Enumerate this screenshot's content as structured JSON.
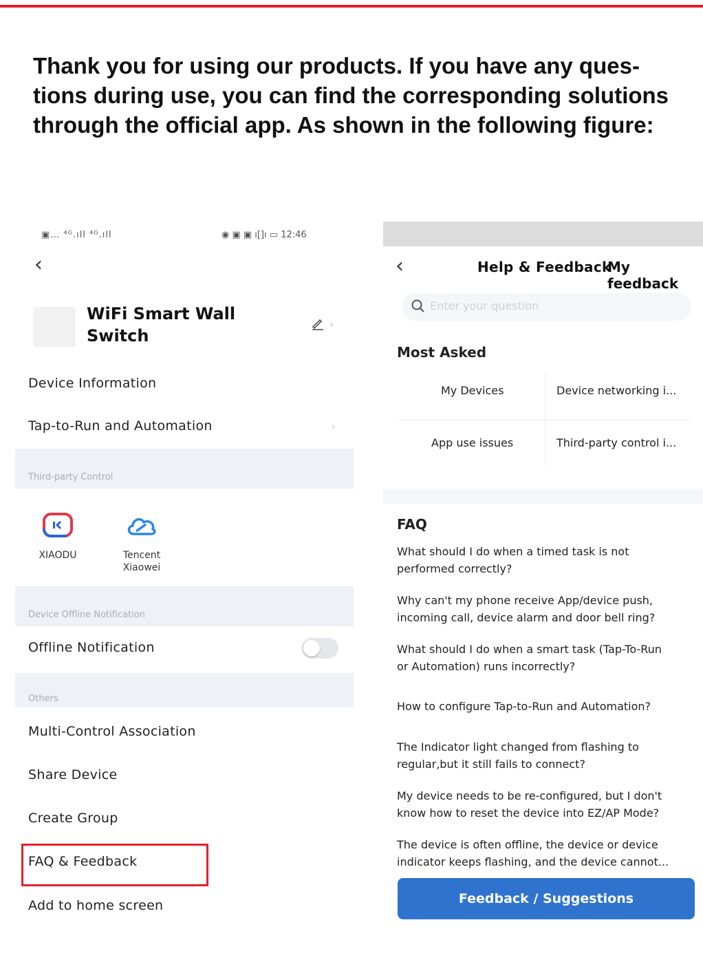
{
  "intro": {
    "line1": "Thank you for using our products. If you have any ques-",
    "line2": "tions during use, you can find the corresponding solutions",
    "line3": "through the official app. As shown in the following figure:"
  },
  "left_screen": {
    "status": {
      "left": "▣… ⁴ᴳ.ıll ⁴ᴳ.ıll",
      "right": "◉ ▣ ▣ ı[]ı ▭ 12:46"
    },
    "back_glyph": "‹",
    "device_name_line1": "WiFi Smart Wall",
    "device_name_line2": "Switch",
    "rows_top": [
      {
        "label": "Device Information"
      },
      {
        "label": "Tap-to-Run and Automation"
      }
    ],
    "third_party": {
      "section_label": "Third-party Control",
      "items": [
        {
          "name_line1": "XIAODU",
          "name_line2": "",
          "icon": "xiaodu-icon"
        },
        {
          "name_line1": "Tencent",
          "name_line2": "Xiaowei",
          "icon": "tencent-cloud-icon"
        }
      ]
    },
    "offline": {
      "section_label": "Device Offline Notification",
      "row_label": "Offline Notification",
      "toggle_on": false
    },
    "others": {
      "section_label": "Others",
      "rows": [
        {
          "label": "Multi-Control Association"
        },
        {
          "label": "Share Device"
        },
        {
          "label": "Create Group"
        },
        {
          "label": "FAQ & Feedback"
        },
        {
          "label": "Add to home screen"
        }
      ]
    },
    "highlight_color": "#e0212b"
  },
  "right_screen": {
    "back_glyph": "‹",
    "title": "Help & Feedback",
    "my_feedback": "My feedback",
    "search_placeholder": "Enter your question",
    "most_asked": {
      "heading": "Most Asked",
      "items": [
        "My Devices",
        "Device networking i...",
        "App use issues",
        "Third-party control i..."
      ]
    },
    "faq": {
      "heading": "FAQ",
      "items": [
        {
          "l1": "What should I do when a timed task is not",
          "l2": "performed correctly?"
        },
        {
          "l1": "Why can't my phone receive App/device push,",
          "l2": "incoming call, device alarm and door bell ring?"
        },
        {
          "l1": "What should I do when a smart task (Tap-To-Run",
          "l2": "or Automation) runs incorrectly?"
        },
        {
          "l1": "How to configure Tap-to-Run and Automation?",
          "l2": ""
        },
        {
          "l1": "The Indicator light changed from flashing to",
          "l2": "regular,but it still fails to connect?"
        },
        {
          "l1": "My device needs to be re-configured, but I don't",
          "l2": "know how to reset the device into EZ/AP Mode?"
        },
        {
          "l1": "The device is often offline, the device or device",
          "l2": "indicator keeps flashing, and the device cannot..."
        }
      ]
    },
    "feedback_button": "Feedback / Suggestions",
    "button_color": "#2f73cf"
  }
}
